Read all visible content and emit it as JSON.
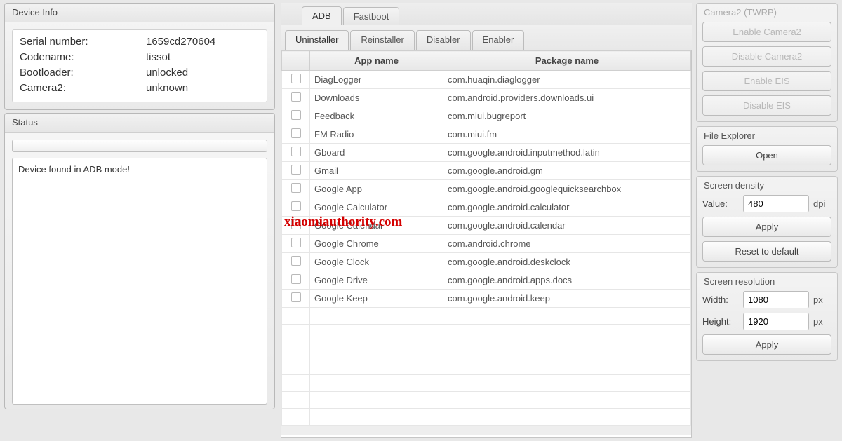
{
  "left": {
    "deviceInfo": {
      "title": "Device Info",
      "labels": {
        "serial": "Serial number:",
        "codename": "Codename:",
        "bootloader": "Bootloader:",
        "camera2": "Camera2:"
      },
      "values": {
        "serial": "1659cd270604",
        "codename": "tissot",
        "bootloader": "unlocked",
        "camera2": "unknown"
      }
    },
    "status": {
      "title": "Status",
      "message": "Device found in ADB mode!"
    }
  },
  "main": {
    "tabs": {
      "adb": "ADB",
      "fastboot": "Fastboot"
    },
    "subtabs": {
      "uninstaller": "Uninstaller",
      "reinstaller": "Reinstaller",
      "disabler": "Disabler",
      "enabler": "Enabler"
    },
    "columns": {
      "app": "App name",
      "pkg": "Package name"
    },
    "rows": [
      {
        "app": "DiagLogger",
        "pkg": "com.huaqin.diaglogger"
      },
      {
        "app": "Downloads",
        "pkg": "com.android.providers.downloads.ui"
      },
      {
        "app": "Feedback",
        "pkg": "com.miui.bugreport"
      },
      {
        "app": "FM Radio",
        "pkg": "com.miui.fm"
      },
      {
        "app": "Gboard",
        "pkg": "com.google.android.inputmethod.latin"
      },
      {
        "app": "Gmail",
        "pkg": "com.google.android.gm"
      },
      {
        "app": "Google App",
        "pkg": "com.google.android.googlequicksearchbox"
      },
      {
        "app": "Google Calculator",
        "pkg": "com.google.android.calculator"
      },
      {
        "app": "Google Calendar",
        "pkg": "com.google.android.calendar"
      },
      {
        "app": "Google Chrome",
        "pkg": "com.android.chrome"
      },
      {
        "app": "Google Clock",
        "pkg": "com.google.android.deskclock"
      },
      {
        "app": "Google Drive",
        "pkg": "com.google.android.apps.docs"
      },
      {
        "app": "Google Keep",
        "pkg": "com.google.android.keep"
      }
    ],
    "blankRows": 7
  },
  "right": {
    "camera2": {
      "title": "Camera2 (TWRP)",
      "enableCamera2": "Enable Camera2",
      "disableCamera2": "Disable Camera2",
      "enableEis": "Enable EIS",
      "disableEis": "Disable EIS"
    },
    "fileExplorer": {
      "title": "File Explorer",
      "open": "Open"
    },
    "density": {
      "title": "Screen density",
      "valueLabel": "Value:",
      "value": "480",
      "unit": "dpi",
      "apply": "Apply",
      "reset": "Reset to default"
    },
    "resolution": {
      "title": "Screen resolution",
      "widthLabel": "Width:",
      "width": "1080",
      "heightLabel": "Height:",
      "height": "1920",
      "unit": "px",
      "apply": "Apply"
    }
  },
  "watermark": "xiaomiauthority.com"
}
